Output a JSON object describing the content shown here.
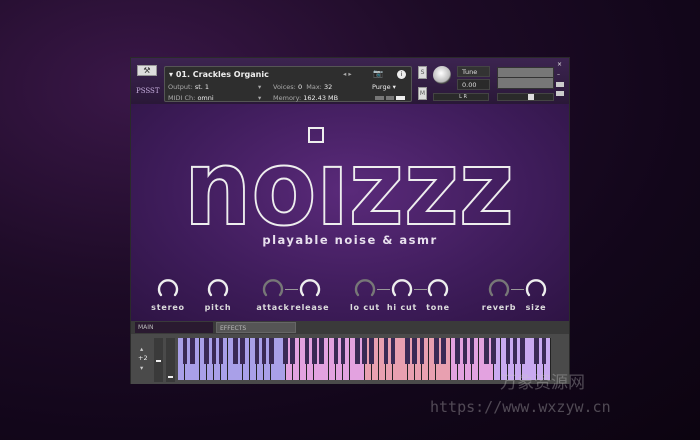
{
  "header": {
    "instrument_name": "01. Crackles Organic",
    "output_label": "Output:",
    "output_value": "st. 1",
    "voices_label": "Voices:",
    "voices_value": "0",
    "max_label": "Max:",
    "max_value": "32",
    "purge_label": "Purge",
    "midi_label": "MIDI Ch:",
    "midi_value": "omni",
    "memory_label": "Memory:",
    "memory_value": "162.43 MB",
    "solo_label": "S",
    "mute_label": "M",
    "tune_label": "Tune",
    "tune_value": "0.00",
    "pan_label": "L  R",
    "brand": "PSSST"
  },
  "main": {
    "logo": "noizzz",
    "subtitle": "playable noise & asmr",
    "knobs": [
      {
        "label": "stereo",
        "active": true
      },
      {
        "label": "pitch",
        "active": true
      },
      {
        "label": "attack",
        "active": false
      },
      {
        "label": "release",
        "active": true
      },
      {
        "label": "lo cut",
        "active": false
      },
      {
        "label": "hi cut",
        "active": true
      },
      {
        "label": "tone",
        "active": true
      },
      {
        "label": "reverb",
        "active": false
      },
      {
        "label": "size",
        "active": true
      }
    ]
  },
  "tabs": [
    {
      "label": "MAIN"
    },
    {
      "label": "EFFECTS"
    }
  ],
  "keyboard": {
    "octave_shift": "+2",
    "zone_colors": [
      "#a9a0e8",
      "#e3a2e0",
      "#e8a0b0",
      "#e3a2e0",
      "#c9aaf0"
    ]
  },
  "watermark": {
    "cn": "万象资源网",
    "url": "https://www.wxzyw.cn"
  }
}
